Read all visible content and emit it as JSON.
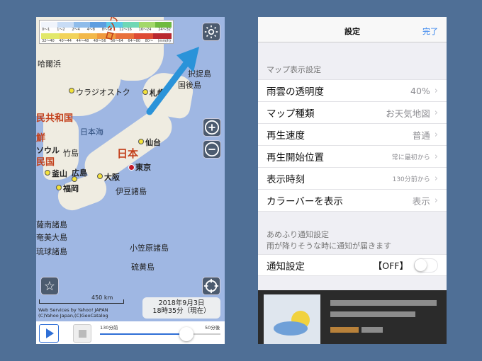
{
  "map": {
    "legend": {
      "row1_labels": [
        "0〜1",
        "1〜2",
        "2〜4",
        "4〜8",
        "8〜12",
        "12〜16",
        "16〜24",
        "24〜32"
      ],
      "row2_labels": [
        "32〜40",
        "40〜44",
        "44〜48",
        "48〜56",
        "56〜64",
        "64〜80",
        "80〜"
      ],
      "unit": "(mm/h)",
      "row1_colors": [
        "#f0f4fb",
        "#c8dcf5",
        "#8fbcea",
        "#5d9de0",
        "#5ec9e6",
        "#6fd7b5",
        "#a3d86a",
        "#6fba3f"
      ],
      "row2_colors": [
        "#e2e86a",
        "#f2d35a",
        "#f2b84a",
        "#ef9a3e",
        "#e8703a",
        "#de4b34",
        "#b9282f"
      ]
    },
    "labels": {
      "harbin": "哈爾浜",
      "vladivostok": "ウラジオストク",
      "russia": "ロシア連邦",
      "china": "民共和国",
      "korea_n": "鮮",
      "seoul": "ソウル",
      "korea_s": "民国",
      "busan": "釜山",
      "fukuoka": "福岡",
      "hiroshima": "広島",
      "osaka": "大阪",
      "tokyo": "東京",
      "sendai": "仙台",
      "sapporo": "札幌",
      "japan": "日本",
      "sea_of_japan": "日本海",
      "takeshima": "竹島",
      "sakhalin": "択捉島",
      "kunashiri": "国後島",
      "izu": "伊豆諸島",
      "nansei": "薩南諸島",
      "amami": "奄美大島",
      "ryukyu": "琉球諸島",
      "ogasawara": "小笠原諸島",
      "iwo": "硫黄島"
    },
    "scale_label": "450 km",
    "credits": [
      "Web Services by Yahoo! JAPAN",
      "(C)Yahoo Japan,(C)GeoCatalog"
    ],
    "date": "2018年9月3日",
    "time": "18時35分（現在）",
    "slider": {
      "start_label": "130分前",
      "end_label": "50分後",
      "position": 0.72
    }
  },
  "settings": {
    "title": "設定",
    "done": "完了",
    "section1_header": "マップ表示設定",
    "rows": [
      {
        "label": "雨雲の透明度",
        "value": "40%"
      },
      {
        "label": "マップ種類",
        "value": "お天気地図"
      },
      {
        "label": "再生速度",
        "value": "普通"
      },
      {
        "label": "再生開始位置",
        "value": "常に最初から"
      },
      {
        "label": "表示時刻",
        "value": "130分前から"
      },
      {
        "label": "カラーバーを表示",
        "value": "表示"
      }
    ],
    "section2_header": "あめふり通知設定",
    "section2_subtitle": "雨が降りそうな時に通知が届きます",
    "notify": {
      "label": "通知設定",
      "value": "【OFF】",
      "on": false
    }
  }
}
